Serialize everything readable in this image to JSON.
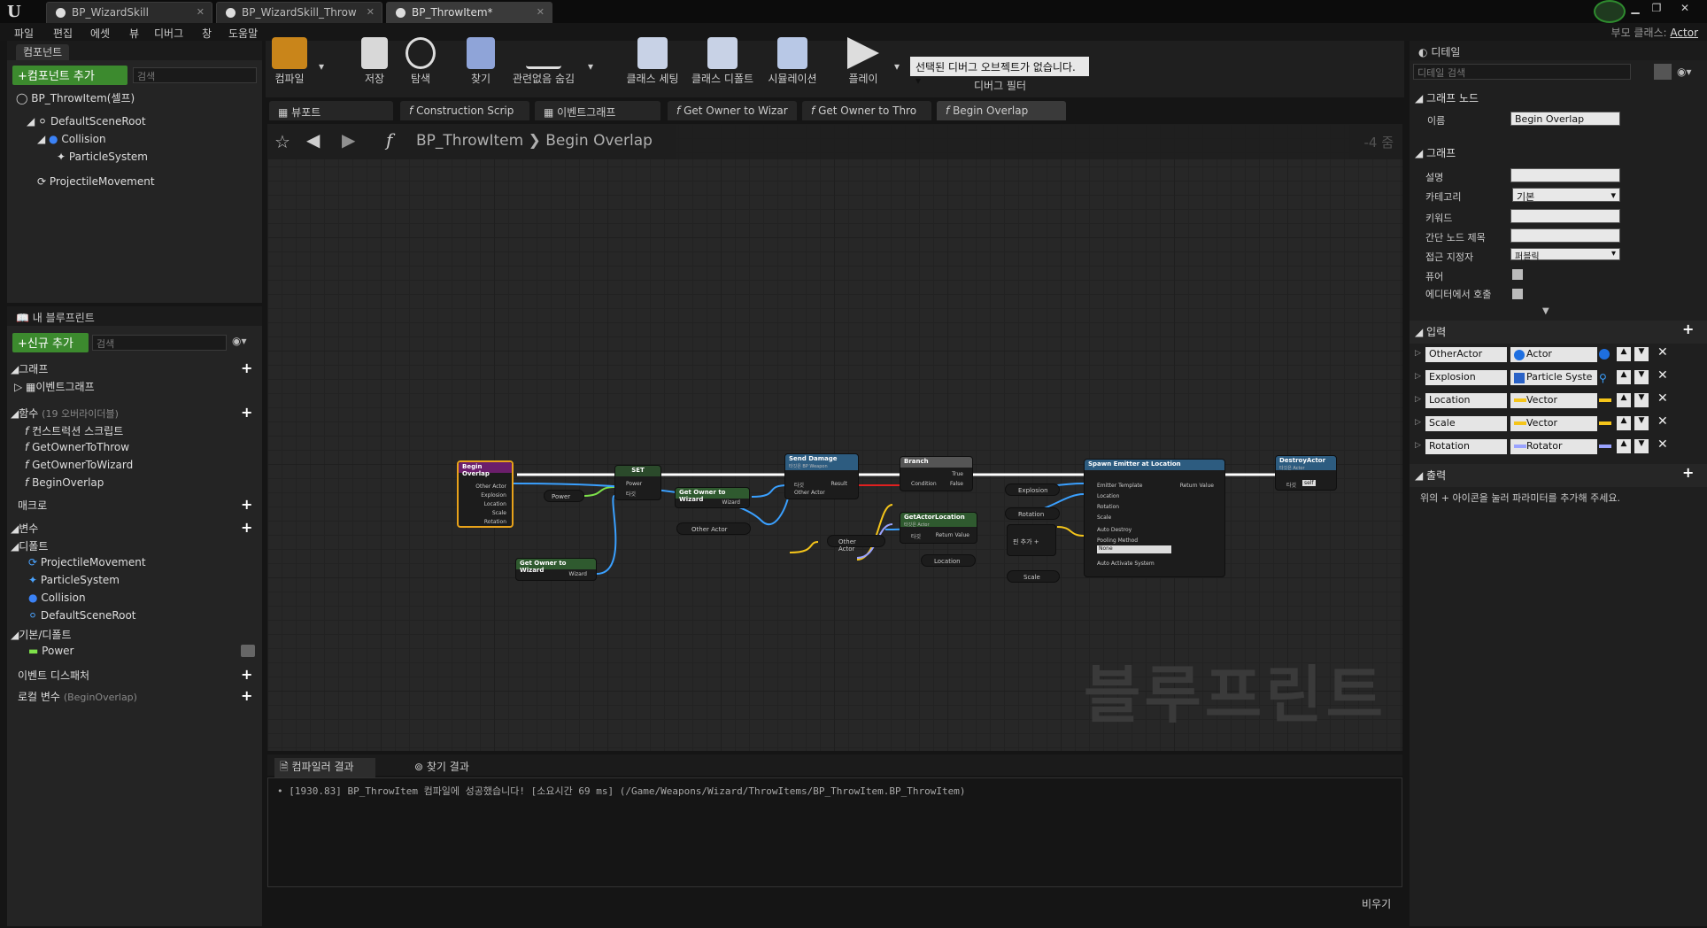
{
  "window": {
    "tabs": [
      {
        "label": "BP_WizardSkill"
      },
      {
        "label": "BP_WizardSkill_Throw"
      },
      {
        "label": "BP_ThrowItem*"
      }
    ],
    "parent_class_label": "부모 클래스:",
    "parent_class_value": "Actor"
  },
  "menubar": [
    "파일",
    "편집",
    "에셋",
    "뷰",
    "디버그",
    "창",
    "도움말"
  ],
  "components_panel": {
    "title": "컴포넌트",
    "add_button": "+컴포넌트 추가",
    "search_placeholder": "검색",
    "self": "BP_ThrowItem(셀프)",
    "tree": [
      "DefaultSceneRoot",
      "Collision",
      "ParticleSystem",
      "ProjectileMovement"
    ]
  },
  "my_blueprint": {
    "title": "내 블루프린트",
    "add_button": "+신규 추가",
    "search_placeholder": "검색",
    "graph_section": "그래프",
    "event_graph": "이벤트그래프",
    "functions_section": "함수",
    "functions_override": "(19 오버라이더블)",
    "functions": [
      "컨스트럭션 스크립트",
      "GetOwnerToThrow",
      "GetOwnerToWizard",
      "BeginOverlap"
    ],
    "macros": "매크로",
    "variables": "변수",
    "default_group": "디폴트",
    "default_vars": [
      "ProjectileMovement",
      "ParticleSystem",
      "Collision",
      "DefaultSceneRoot"
    ],
    "basic_group": "기본/디폴트",
    "basic_vars": [
      "Power"
    ],
    "event_dispatchers": "이벤트 디스패처",
    "local_vars": "로컬 변수",
    "local_vars_scope": "(BeginOverlap)"
  },
  "toolbar": {
    "items": [
      "컴파일",
      "저장",
      "탐색",
      "찾기",
      "관련없음 숨김",
      "클래스 세팅",
      "클래스 디폴트",
      "시뮬레이션",
      "플레이"
    ],
    "debug_dropdown": "선택된 디버그 오브젝트가 없습니다.",
    "debug_filter": "디버그 필터"
  },
  "graph_tabs": [
    "뷰포트",
    "Construction Scrip",
    "이벤트그래프",
    "Get Owner to Wizar",
    "Get Owner to Thro",
    "Begin Overlap"
  ],
  "breadcrumb": {
    "blueprint": "BP_ThrowItem",
    "function": "Begin Overlap",
    "zoom": "-4 줌"
  },
  "graph": {
    "watermark": "블루프린트",
    "nodes": {
      "begin_overlap": {
        "title": "Begin Overlap",
        "pins": [
          "Other Actor",
          "Explosion",
          "Location",
          "Scale",
          "Rotation"
        ]
      },
      "set": {
        "title": "SET",
        "pins": [
          "Power",
          "타깃"
        ]
      },
      "power_get": "Power",
      "get_owner_wizard_1": {
        "title": "Get Owner to Wizard",
        "pin": "Wizard"
      },
      "get_owner_wizard_2": {
        "title": "Get Owner to Wizard",
        "pin": "Wizard"
      },
      "other_actor_1": "Other Actor",
      "send_damage": {
        "title": "Send Damage",
        "sub": "타깃은 BP Weapon",
        "pins": [
          "타깃",
          "Other Actor"
        ],
        "out": "Result"
      },
      "branch": {
        "title": "Branch",
        "pins": [
          "Condition"
        ],
        "outs": [
          "True",
          "False"
        ]
      },
      "get_actor_location": {
        "title": "GetActorLocation",
        "sub": "타깃은 Actor",
        "pin": "타깃",
        "out": "Return Value"
      },
      "other_actor_2": "Other Actor",
      "explosion_get": "Explosion",
      "rotation_get": "Rotation",
      "location_get": "Location",
      "scale_get": "Scale",
      "make_add": "핀 추가",
      "spawn_emitter": {
        "title": "Spawn Emitter at Location",
        "pins": [
          "Emitter Template",
          "Location",
          "Rotation",
          "Scale",
          "Auto Destroy",
          "Pooling Method",
          "Auto Activate System"
        ],
        "out": "Return Value",
        "pooling_value": "None"
      },
      "destroy_actor": {
        "title": "DestroyActor",
        "sub": "타깃은 Actor",
        "pin": "타깃",
        "self": "self"
      }
    }
  },
  "output_tabs": [
    "컴파일러 결과",
    "찾기 결과"
  ],
  "console": {
    "line": "[1930.83] BP_ThrowItem 컴파일에 성공했습니다! [소요시간 69 ms] (/Game/Weapons/Wizard/ThrowItems/BP_ThrowItem.BP_ThrowItem)",
    "clear_button": "비우기"
  },
  "details": {
    "title": "디테일",
    "search_placeholder": "디테일 검색",
    "graph_node_section": "그래프 노드",
    "name_label": "이름",
    "name_value": "Begin Overlap",
    "graph_section": "그래프",
    "description_label": "설명",
    "category_label": "카테고리",
    "category_value": "기본",
    "keywords_label": "키워드",
    "compact_title_label": "간단 노드 제목",
    "access_label": "접근 지정자",
    "access_value": "퍼블릭",
    "pure_label": "퓨어",
    "editor_call_label": "에디터에서 호출",
    "inputs_section": "입력",
    "inputs": [
      {
        "name": "OtherActor",
        "type": "Actor",
        "color": "#1e6fe0"
      },
      {
        "name": "Explosion",
        "type": "Particle Syste",
        "color": "#2b63c7"
      },
      {
        "name": "Location",
        "type": "Vector",
        "color": "#f5c51a"
      },
      {
        "name": "Scale",
        "type": "Vector",
        "color": "#f5c51a"
      },
      {
        "name": "Rotation",
        "type": "Rotator",
        "color": "#9aa3ff"
      }
    ],
    "outputs_section": "출력",
    "outputs_hint": "위의 + 아이콘을 눌러 파라미터를 추가해 주세요."
  }
}
